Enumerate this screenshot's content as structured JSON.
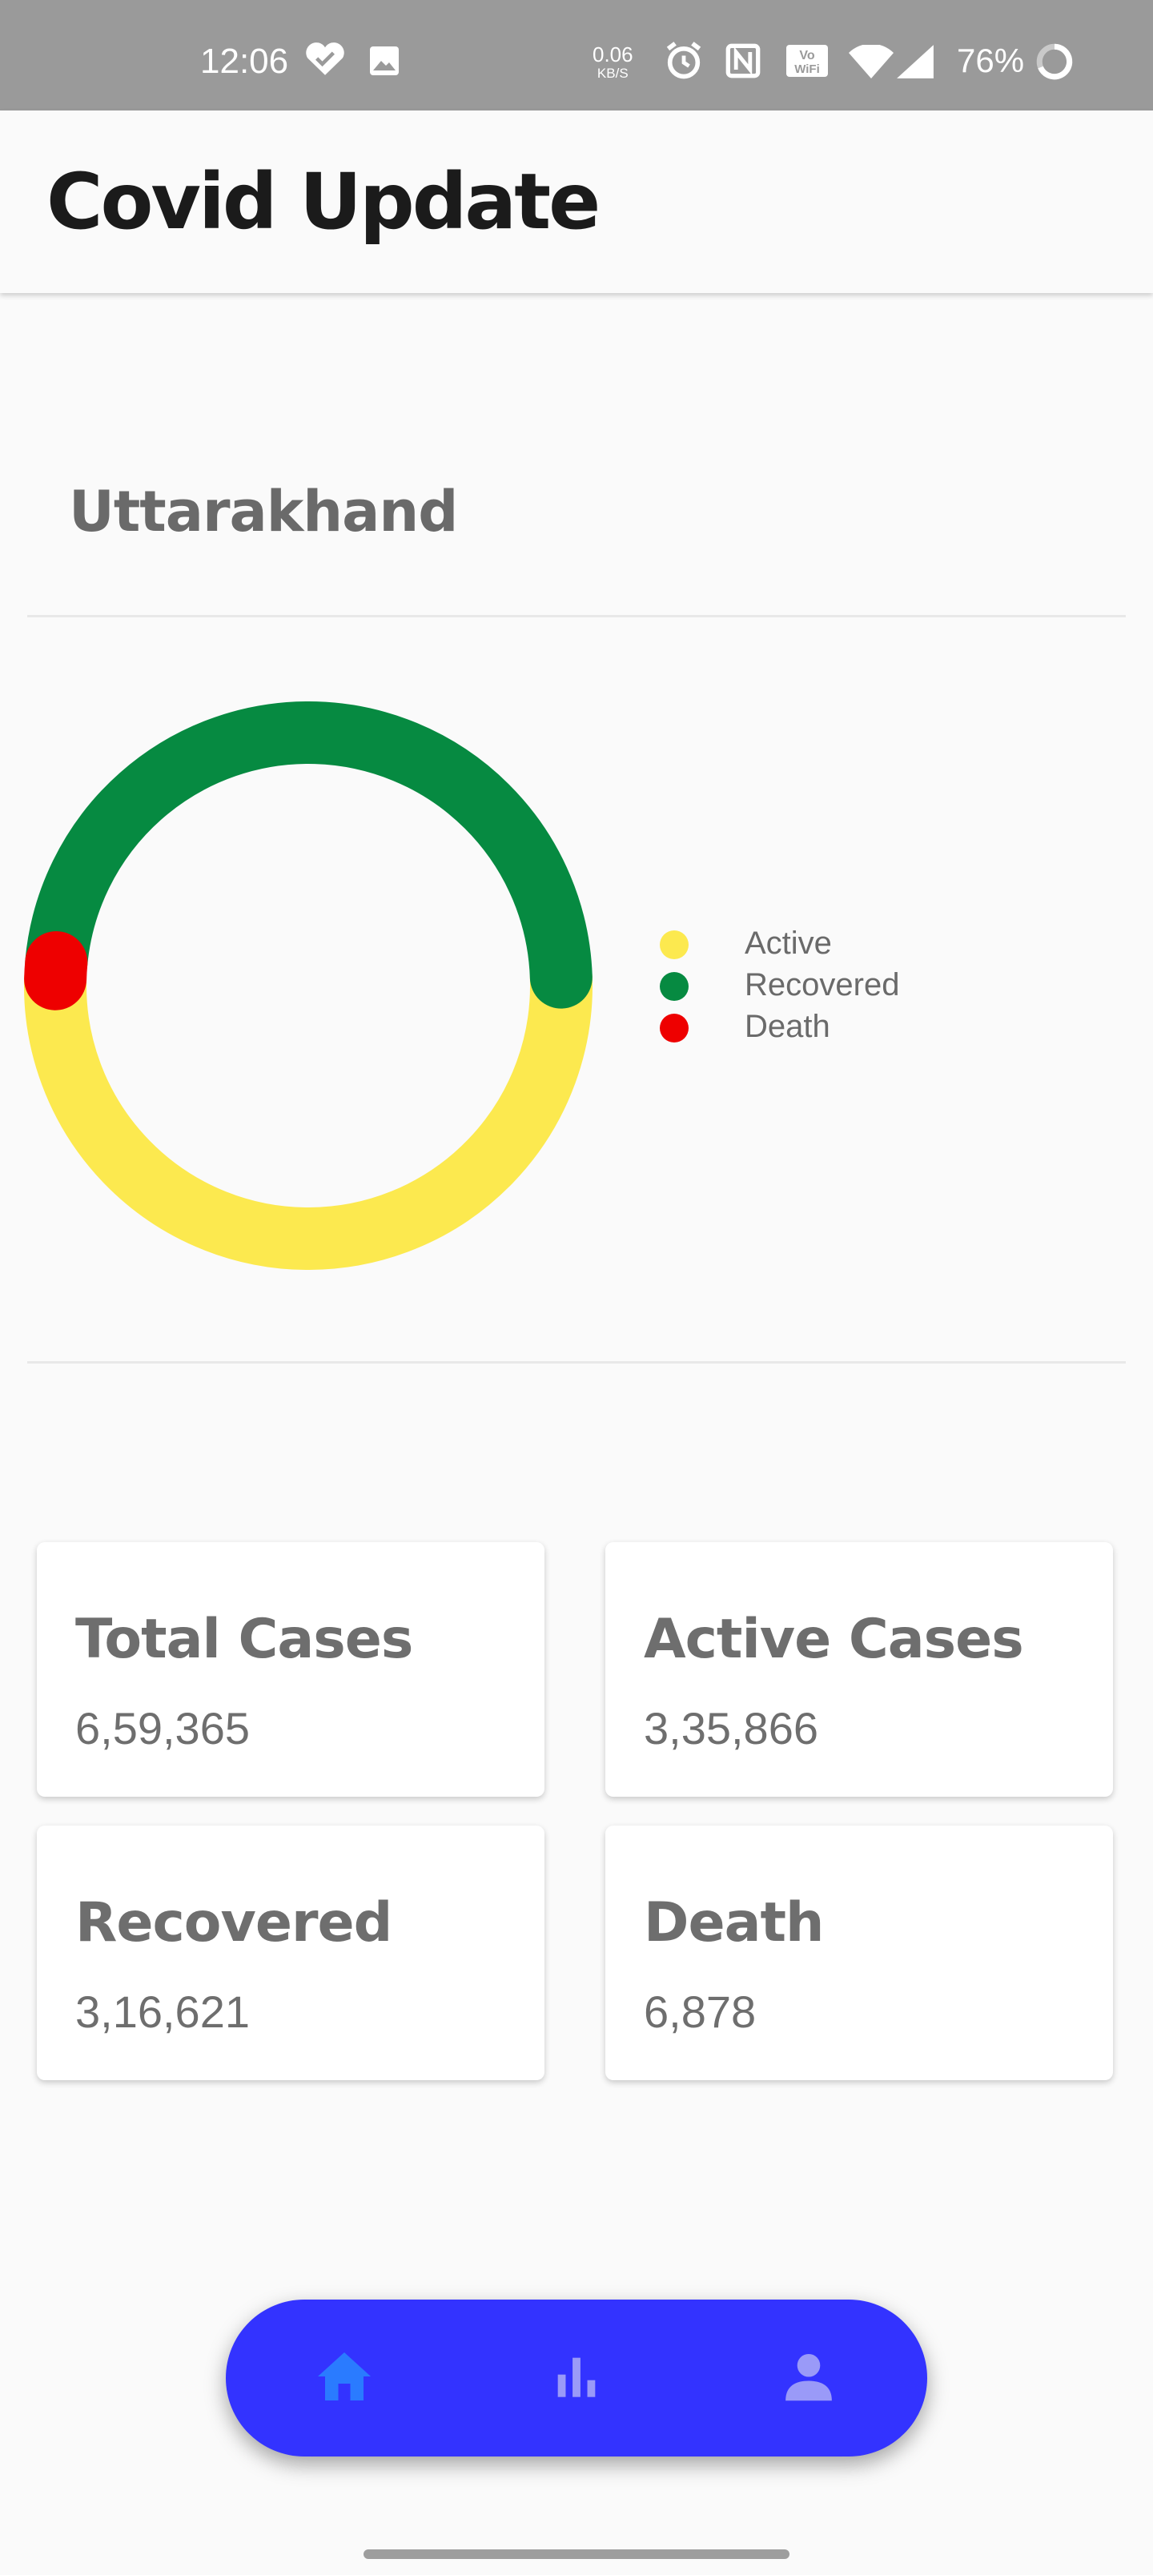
{
  "status_bar": {
    "time": "12:06",
    "net_speed": "0.06",
    "net_unit": "KB/S",
    "battery": "76%",
    "icons": [
      "heart-check-icon",
      "image-icon",
      "alarm-icon",
      "nfc-icon",
      "vowifi-icon",
      "wifi-icon",
      "signal-icon",
      "battery-ring-icon"
    ]
  },
  "app_bar": {
    "title": "Covid Update"
  },
  "region": "Uttarakhand",
  "colors": {
    "active": "#FCE94F",
    "recovered": "#068A41",
    "death": "#EE0000",
    "nav": "#3333FF",
    "nav_icon_active": "#2A7BFF",
    "nav_icon": "#9A9AF8"
  },
  "chart_data": {
    "type": "pie",
    "donut": true,
    "categories": [
      "Active",
      "Recovered",
      "Death"
    ],
    "values": [
      335866,
      316621,
      6878
    ]
  },
  "legend": [
    {
      "label": "Active",
      "color": "#FCE94F"
    },
    {
      "label": "Recovered",
      "color": "#068A41"
    },
    {
      "label": "Death",
      "color": "#EE0000"
    }
  ],
  "stats": {
    "total": {
      "label": "Total Cases",
      "value": "6,59,365"
    },
    "active": {
      "label": "Active Cases",
      "value": "3,35,866"
    },
    "recovered": {
      "label": "Recovered",
      "value": "3,16,621"
    },
    "death": {
      "label": "Death",
      "value": "6,878"
    }
  },
  "bottom_nav": [
    {
      "icon": "home-icon",
      "selected": true
    },
    {
      "icon": "bar-chart-icon",
      "selected": false
    },
    {
      "icon": "person-icon",
      "selected": false
    }
  ]
}
